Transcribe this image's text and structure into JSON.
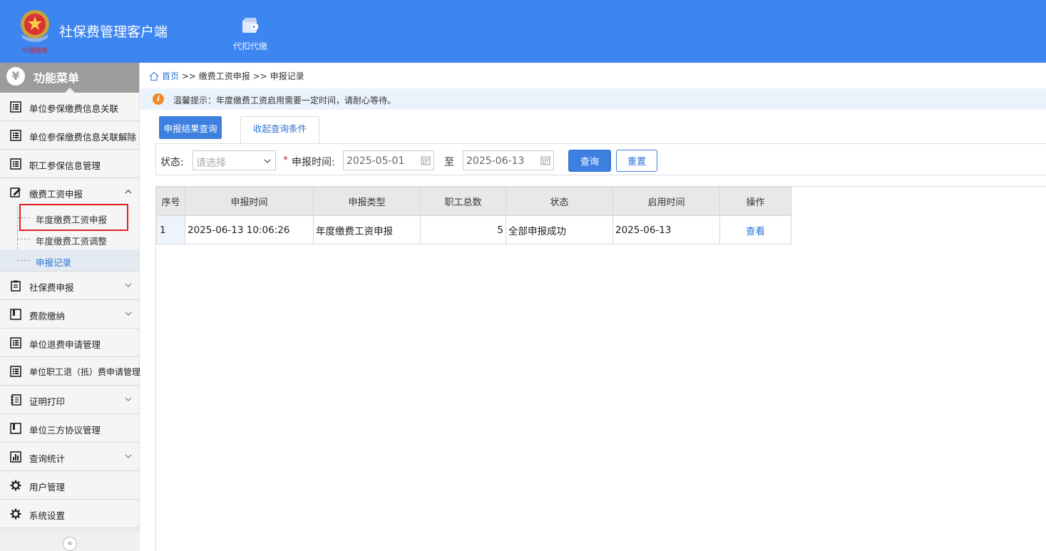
{
  "header": {
    "app_title": "社保费管理客户端",
    "logo_text": "中国税务",
    "nav": [
      {
        "label": "代扣代缴",
        "icon": "wallet-icon"
      }
    ]
  },
  "sidebar": {
    "title": "功能菜单",
    "items": [
      {
        "label": "单位参保缴费信息关联",
        "icon": "list-icon"
      },
      {
        "label": "单位参保缴费信息关联解除",
        "icon": "list-icon"
      },
      {
        "label": "职工参保信息管理",
        "icon": "list-icon"
      },
      {
        "label": "缴费工资申报",
        "icon": "edit-icon",
        "expanded": true
      },
      {
        "label": "社保费申报",
        "icon": "clipboard-icon"
      },
      {
        "label": "费款缴纳",
        "icon": "book-icon"
      },
      {
        "label": "单位退费申请管理",
        "icon": "list-icon"
      },
      {
        "label": "单位职工退（抵）费申请管理",
        "icon": "list-icon"
      },
      {
        "label": "证明打印",
        "icon": "notebook-icon"
      },
      {
        "label": "单位三方协议管理",
        "icon": "book-icon"
      },
      {
        "label": "查询统计",
        "icon": "chart-icon"
      },
      {
        "label": "用户管理",
        "icon": "gear-icon"
      },
      {
        "label": "系统设置",
        "icon": "gear-icon"
      }
    ],
    "subitems": [
      {
        "label": "年度缴费工资申报"
      },
      {
        "label": "年度缴费工资调整"
      },
      {
        "label": "申报记录",
        "active": true
      }
    ],
    "collapse_symbol": "«"
  },
  "breadcrumb": {
    "home": "首页",
    "separator": ">>",
    "level1": "缴费工资申报",
    "level2": "申报记录"
  },
  "tip": {
    "icon": "i",
    "text": "温馨提示：年度缴费工资启用需要一定时间，请耐心等待。"
  },
  "tabs": {
    "result_query": "申报结果查询",
    "collapse_conditions": "收起查询条件"
  },
  "filter": {
    "status_label": "状态:",
    "status_placeholder": "请选择",
    "required_mark": "*",
    "time_label": "申报时间:",
    "date_from": "2025-05-01",
    "to_label": "至",
    "date_to": "2025-06-13",
    "query_button": "查询",
    "reset_button": "重置"
  },
  "table": {
    "columns": [
      "序号",
      "申报时间",
      "申报类型",
      "职工总数",
      "状态",
      "启用时间",
      "操作"
    ],
    "rows": [
      {
        "index": "1",
        "time": "2025-06-13 10:06:26",
        "type": "年度缴费工资申报",
        "count": "5",
        "status": "全部申报成功",
        "start": "2025-06-13",
        "action": "查看"
      }
    ]
  },
  "colors": {
    "header_bg": "#3d85f0",
    "primary": "#3d80e0",
    "link": "#2b74d4",
    "highlight_box": "#e02020"
  }
}
